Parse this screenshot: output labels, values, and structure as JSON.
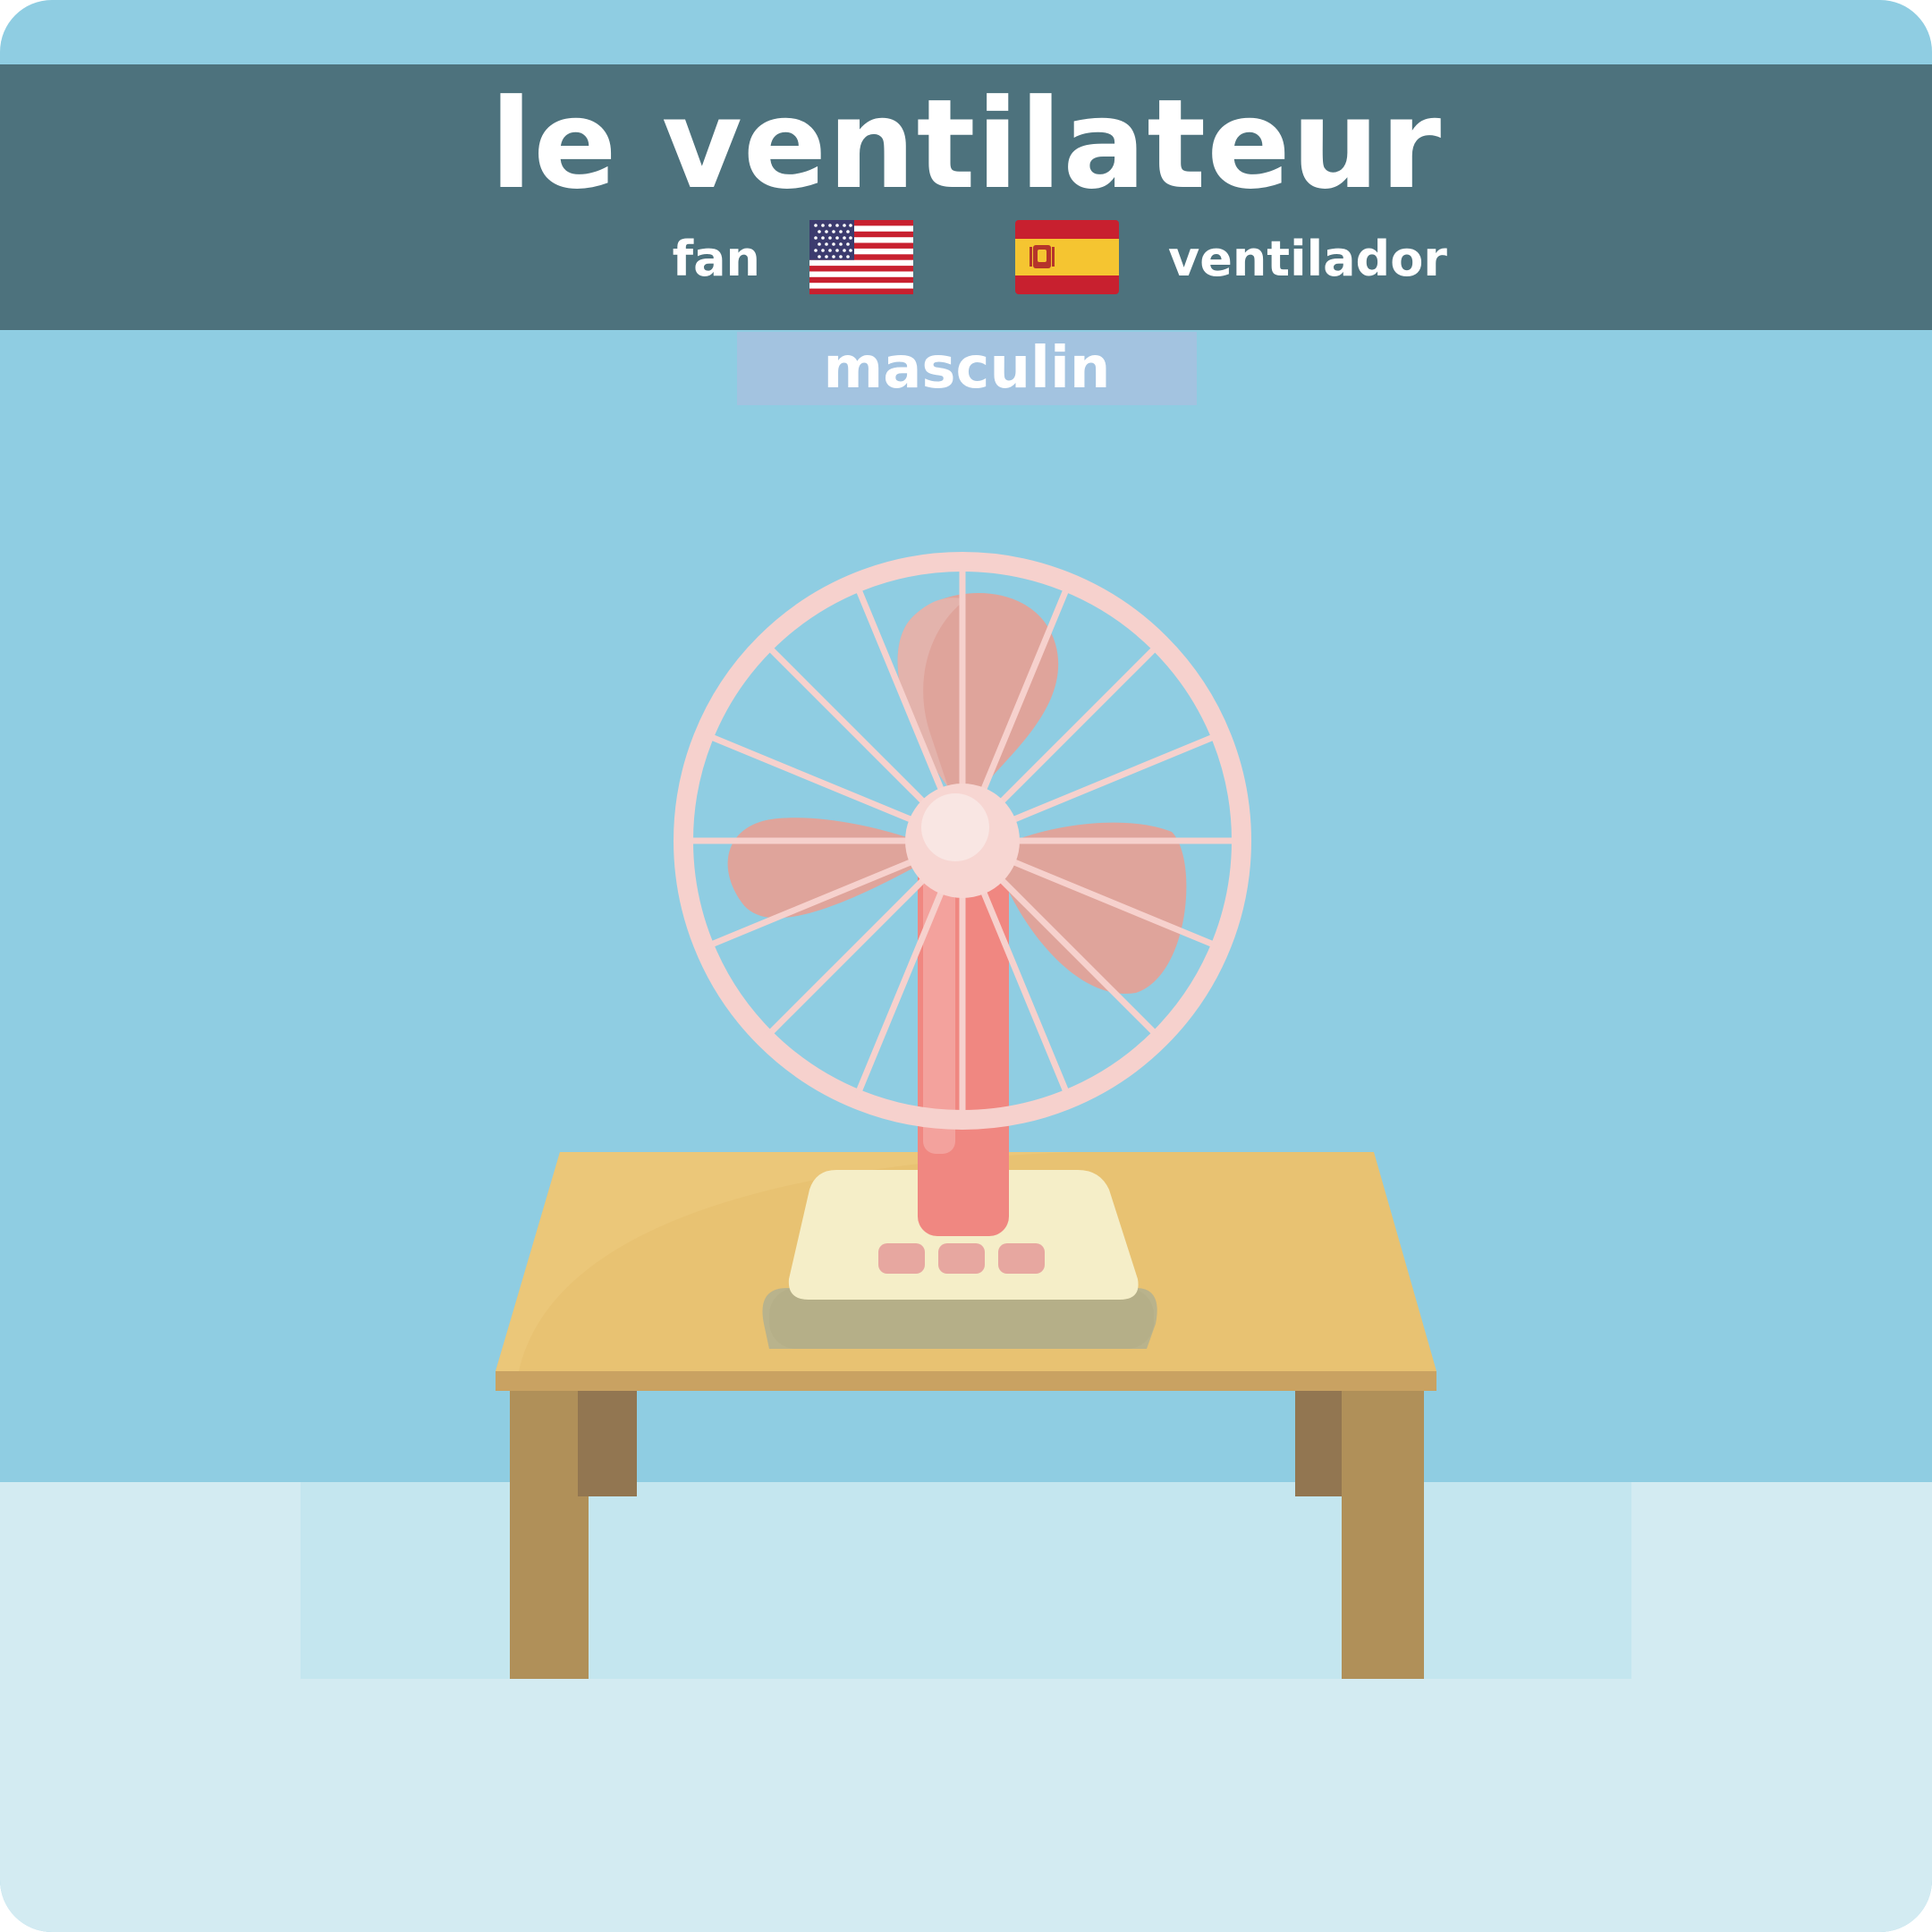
{
  "card": {
    "word": "le ventilateur",
    "gender": "masculin",
    "translations": [
      {
        "lang": "en",
        "flag_icon": "us-flag-icon",
        "text": "fan"
      },
      {
        "lang": "es",
        "flag_icon": "spain-flag-icon",
        "text": "ventilador"
      }
    ]
  },
  "illustration": {
    "subject": "table-fan-icon"
  },
  "colors": {
    "background": "#8fcde2",
    "header": "#4d727d",
    "gender_badge": "#a3c3e0",
    "floor": "#d3ebf2",
    "text": "#ffffff",
    "table_top": "#e8c272",
    "table_leg": "#b09059",
    "fan_guard": "#f6d1cd",
    "fan_blade": "#dfa49b",
    "fan_pole": "#f08781",
    "fan_base": "#f5eec8"
  }
}
